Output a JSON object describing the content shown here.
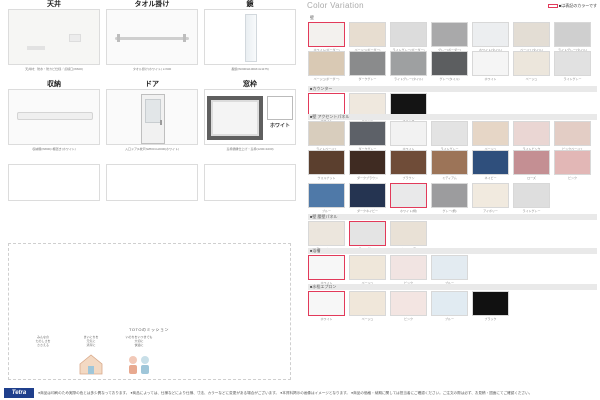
{
  "left": {
    "cells": [
      {
        "title": "天井",
        "caption": "天井材：防水・防カビ仕様／点検口(W600)"
      },
      {
        "title": "タオル掛け",
        "caption": "タオル掛け(ホワイト) L=600"
      },
      {
        "title": "鏡",
        "caption": "長鏡(W300/H1000/t×H1175)"
      },
      {
        "title": "収納",
        "caption": "収納棚(W800)×棚置き(ホワイト)"
      },
      {
        "title": "ドア",
        "caption": "入口ドア(1枚戸)W800×H2000(ホワイト)"
      },
      {
        "title": "窓枠",
        "caption": "窓枠額縁仕上げ・窓枠(1200×1000)"
      }
    ],
    "window_badge": "ホワイト",
    "mission_title": "TOTOのミッション",
    "missions": [
      "みんなの\nたのしさを\nささえる",
      "まいにちを\n元気に\n清潔に",
      "いのちをいつまでも\n大切に\n快適に"
    ]
  },
  "right": {
    "title": "Color Variation",
    "note": "■は表記のカラーです",
    "sections": [
      {
        "label": "壁",
        "band": false,
        "swatches": [
          {
            "label": "ホワイト(ボーダー)",
            "color": "#f3f1ee",
            "selected": true
          },
          {
            "label": "ベージュ(ボーダー)",
            "color": "#e7ddd0",
            "selected": false
          },
          {
            "label": "ライトグレー(ボーダー)",
            "color": "#dcdcdc",
            "selected": false
          },
          {
            "label": "グレー(ボーダー)",
            "color": "#a9a9aa",
            "selected": false
          },
          {
            "label": "ホワイト(タイル)",
            "color": "#eceef0",
            "selected": false
          },
          {
            "label": "ベージュ(タイル)",
            "color": "#e3ddd4",
            "selected": false
          },
          {
            "label": "ライトグレー(タイル)",
            "color": "#cfcfcf",
            "selected": false
          }
        ]
      },
      {
        "label": "",
        "band": false,
        "swatches": [
          {
            "label": "ベージュ(ボーダー)",
            "color": "#d9c9b4",
            "selected": false
          },
          {
            "label": "ダークグレー",
            "color": "#8a8b8c",
            "selected": false
          },
          {
            "label": "ライトグレー(タイル)",
            "color": "#9ea0a1",
            "selected": false
          },
          {
            "label": "グレー(タイル)",
            "color": "#5c5e60",
            "selected": false
          },
          {
            "label": "ホワイト",
            "color": "#f5f5f5",
            "selected": false
          },
          {
            "label": "ベージュ",
            "color": "#ece6dc",
            "selected": false
          },
          {
            "label": "ライトグレー",
            "color": "#e1e1e1",
            "selected": false
          }
        ]
      },
      {
        "label": "■カウンター",
        "band": true,
        "swatches": [
          {
            "label": "ホワイト",
            "color": "#ffffff",
            "selected": true
          },
          {
            "label": "ベージュ",
            "color": "#efe8de",
            "selected": false
          },
          {
            "label": "ブラック",
            "color": "#141414",
            "selected": false
          }
        ]
      },
      {
        "label": "■壁 アクセントパネル",
        "band": true,
        "swatches": [
          {
            "label": "ライトベージュ",
            "color": "#d8cdbd",
            "selected": false
          },
          {
            "label": "ダークグレー",
            "color": "#5d6168",
            "selected": false
          },
          {
            "label": "ホワイト",
            "color": "#f2f2f2",
            "selected": false
          },
          {
            "label": "ライトグレー",
            "color": "#e3e3e3",
            "selected": false
          },
          {
            "label": "ベージュ",
            "color": "#e6d6c6",
            "selected": false
          },
          {
            "label": "ライトピンク",
            "color": "#ead6d3",
            "selected": false
          },
          {
            "label": "ピンクベージュ",
            "color": "#e3cdc5",
            "selected": false
          }
        ]
      },
      {
        "label": "",
        "band": false,
        "swatches": [
          {
            "label": "ウォルナット",
            "color": "#5b3f2e",
            "selected": false
          },
          {
            "label": "ダークブラウン",
            "color": "#3f2b22",
            "selected": false
          },
          {
            "label": "ブラウン",
            "color": "#6f4c38",
            "selected": false
          },
          {
            "label": "ミディアム",
            "color": "#9c7458",
            "selected": false
          },
          {
            "label": "ネイビー",
            "color": "#2f4f7c",
            "selected": false
          },
          {
            "label": "ローズ",
            "color": "#c48f93",
            "selected": false
          },
          {
            "label": "ピンク",
            "color": "#e2b7b6",
            "selected": false
          }
        ]
      },
      {
        "label": "",
        "band": false,
        "swatches": [
          {
            "label": "ブルー",
            "color": "#4f79a8",
            "selected": false
          },
          {
            "label": "ダークネイビー",
            "color": "#253451",
            "selected": false
          },
          {
            "label": "ホワイト(柄)",
            "color": "#e9e9ea",
            "selected": true
          },
          {
            "label": "グレー(柄)",
            "color": "#9c9c9e",
            "selected": false
          },
          {
            "label": "アイボリー",
            "color": "#f1eadf",
            "selected": false
          },
          {
            "label": "ライトグレー",
            "color": "#dedede",
            "selected": false
          }
        ]
      },
      {
        "label": "■壁 腰壁パネル",
        "band": true,
        "swatches": [
          {
            "label": "ライトベージュ",
            "color": "#ece6dd",
            "selected": false
          },
          {
            "label": "ライトグレー",
            "color": "#e4e4e4",
            "selected": true
          },
          {
            "label": "ベージュ(柄)",
            "color": "#e9e1d6",
            "selected": false
          }
        ]
      },
      {
        "label": "■浴槽",
        "band": true,
        "swatches": [
          {
            "label": "ホワイト",
            "color": "#f7f7f7",
            "selected": true
          },
          {
            "label": "ベージュ",
            "color": "#efe7da",
            "selected": false
          },
          {
            "label": "ピンク",
            "color": "#f1e4e2",
            "selected": false
          },
          {
            "label": "ブルー",
            "color": "#e3ebf1",
            "selected": false
          }
        ]
      },
      {
        "label": "■水栓エプロン",
        "band": true,
        "swatches": [
          {
            "label": "ホワイト",
            "color": "#f7f7f7",
            "selected": true
          },
          {
            "label": "ベージュ",
            "color": "#f0e7da",
            "selected": false
          },
          {
            "label": "ピンク",
            "color": "#f3e5e2",
            "selected": false
          },
          {
            "label": "ブルー",
            "color": "#e1ebf2",
            "selected": false
          },
          {
            "label": "ブラック",
            "color": "#111111",
            "selected": false
          }
        ]
      }
    ]
  },
  "footer": {
    "logo": "Tetra",
    "text": "●商品は印刷のため実際の色とは多少異なっております。 ●商品によっては、仕様などにより仕様、寸法、カラーなどに変更がある場合がございます。 ●本資料掲示の画像はイメージとなります。 ●商品の価格・納期に関しては担当者にご確認ください。ご注文の際は必ず、お見積・図面にてご確認ください。"
  }
}
